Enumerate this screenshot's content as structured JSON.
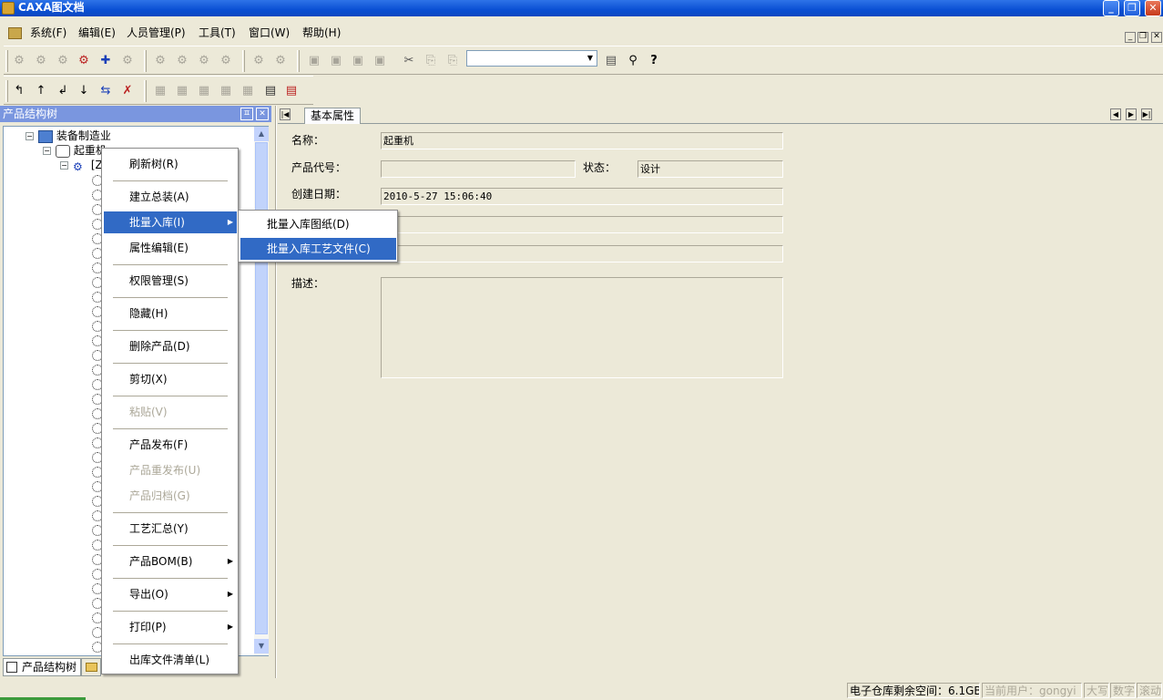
{
  "window": {
    "title": "CAXA图文档"
  },
  "menu": [
    "系统(F)",
    "编辑(E)",
    "人员管理(P)",
    "工具(T)",
    "窗口(W)",
    "帮助(H)"
  ],
  "panel": {
    "title": "产品结构树",
    "pin": "ㅍ",
    "close": "✕"
  },
  "tree": {
    "root": "装备制造业",
    "child": "起重机",
    "grandchild": "[Z"
  },
  "panel_tabs": [
    "产品结构树"
  ],
  "context_menu": [
    {
      "label": "刷新树(R)"
    },
    {
      "label": "建立总装(A)"
    },
    {
      "label": "批量入库(I)",
      "highlighted": true,
      "submenu": true
    },
    {
      "label": "属性编辑(E)"
    },
    {
      "label": "权限管理(S)"
    },
    {
      "label": "隐藏(H)"
    },
    {
      "label": "删除产品(D)"
    },
    {
      "label": "剪切(X)"
    },
    {
      "label": "粘贴(V)",
      "disabled": true
    },
    {
      "label": "产品发布(F)"
    },
    {
      "label": "产品重发布(U)",
      "disabled": true
    },
    {
      "label": "产品归档(G)",
      "disabled": true
    },
    {
      "label": "工艺汇总(Y)"
    },
    {
      "label": "产品BOM(B)",
      "submenu": true
    },
    {
      "label": "导出(O)",
      "submenu": true
    },
    {
      "label": "打印(P)",
      "submenu": true
    },
    {
      "label": "出库文件清单(L)"
    }
  ],
  "submenu": [
    {
      "label": "批量入库图纸(D)"
    },
    {
      "label": "批量入库工艺文件(C)",
      "highlighted": true
    }
  ],
  "right": {
    "tab": "基本属性",
    "name_label": "名称：",
    "name_value": "起重机",
    "code_label": "产品代号：",
    "code_value": "",
    "state_label": "状态：",
    "state_value": "设计",
    "date_label": "创建日期：",
    "date_value": "2010-5-27 15:06:40",
    "desc_label": "描述：",
    "desc_value": ""
  },
  "status": {
    "space": "电子仓库剩余空间：6.1GB",
    "user": "当前用户：gongyi",
    "caps": "大写",
    "num": "数字",
    "scroll": "滚动"
  }
}
